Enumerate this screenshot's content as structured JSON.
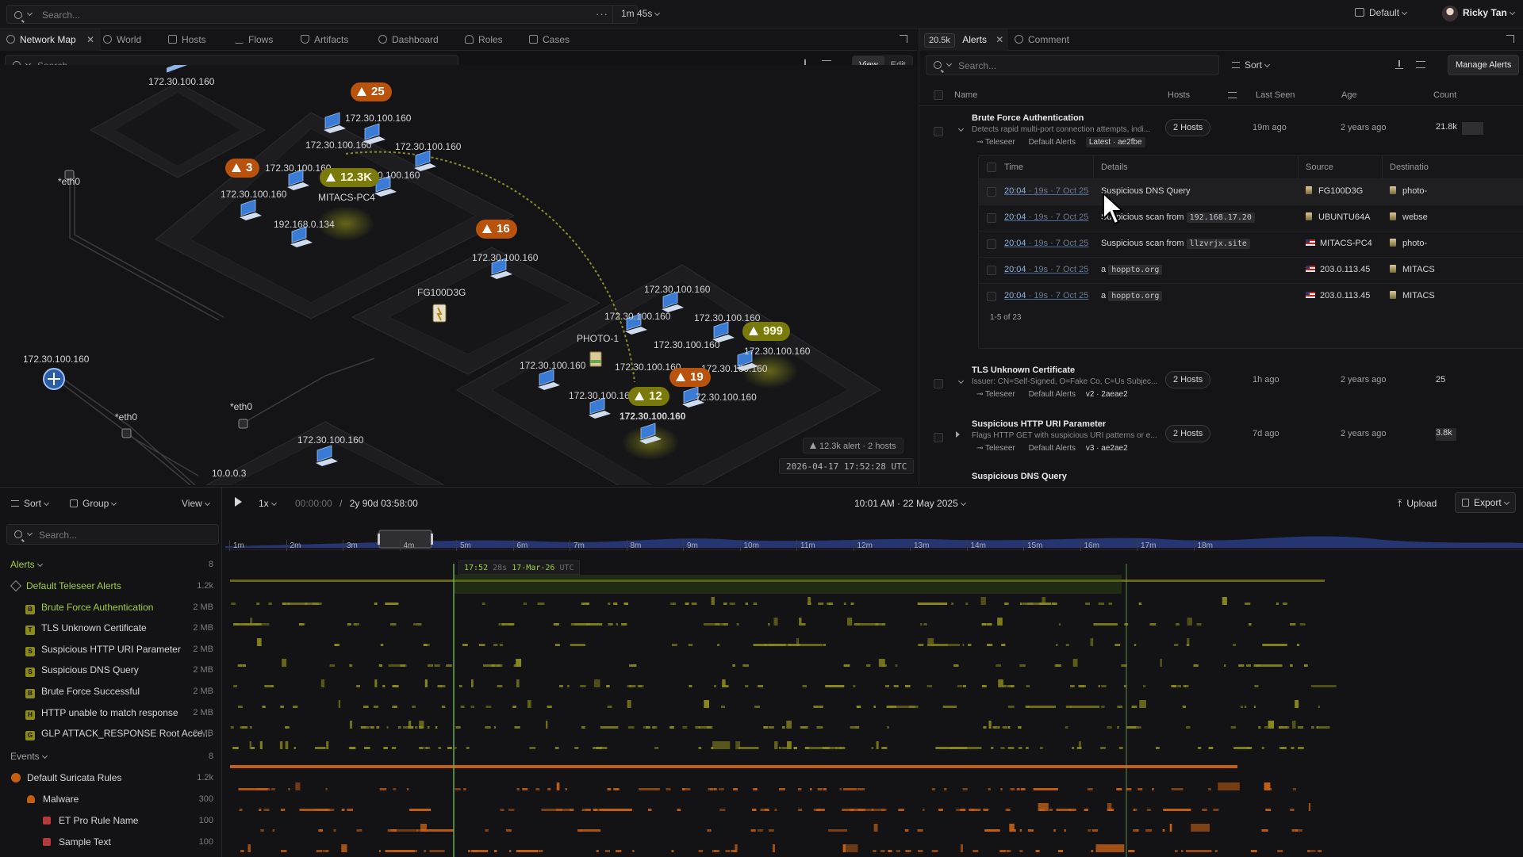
{
  "topbar": {
    "search_placeholder": "Search...",
    "time_range": "1m 45s",
    "layout": "Default",
    "user": "Ricky Tan"
  },
  "left_tabs": [
    {
      "label": "Network Map",
      "active": true
    },
    {
      "label": "World"
    },
    {
      "label": "Hosts"
    },
    {
      "label": "Flows"
    },
    {
      "label": "Artifacts"
    },
    {
      "label": "Dashboard"
    },
    {
      "label": "Roles"
    },
    {
      "label": "Cases"
    }
  ],
  "map": {
    "search_placeholder": "Search...",
    "view_label": "View",
    "edit_label": "Edit",
    "badges": [
      "25",
      "3",
      "12.3K",
      "16",
      "999",
      "19",
      "12"
    ],
    "labels": {
      "n1": "172.30.100.160",
      "n2": "172.30.100.160",
      "n3": "172.30.100.160",
      "n4": "172.30.100.160",
      "n5": "172.30.100.160",
      "n6": "172.30.100.160",
      "n7": "0.100.160",
      "mitacs": "MITACS-PC4",
      "ip192": "192.168.0.134",
      "eth0a": "*eth0",
      "eth0b": "*eth0",
      "eth0c": "*eth0",
      "fg": "FG100D3G",
      "left1": "172.30.100.160",
      "mid16": "172.30.100.160",
      "photo": "PHOTO-1",
      "r1": "172.30.100.160",
      "r2": "172.30.100.160",
      "r3": "172.30.100.160",
      "r4": "172.30.100.160",
      "r5": "172.30.100.160",
      "r6": "172.30.100.160",
      "r7": "172.30.100.160",
      "r8": "172.30.100.160",
      "r9": "72.30.100.160",
      "r10": "172.30.100.160",
      "r11": "172.30.100.160",
      "bottom1": "172.30.100.160",
      "ten": "10.0.0.3",
      "bottom2": "172.30.100.160"
    },
    "alert_chip": "12.3k alert · 2 hosts",
    "timestamp": "2026-04-17 17:52:28 UTC"
  },
  "alerts_panel": {
    "count_badge": "20.5k",
    "tab_alerts": "Alerts",
    "tab_comment": "Comment",
    "search_placeholder": "Search...",
    "sort_label": "Sort",
    "manage_label": "Manage Alerts",
    "columns": [
      "Name",
      "Hosts",
      "Last Seen",
      "Age",
      "Count"
    ],
    "rows": [
      {
        "name": "Brute Force Authentication",
        "desc": "Detects rapid multi-port connection attempts, indi...",
        "source": "Teleseer",
        "group": "Default Alerts",
        "version": "Latest · ae2fbe",
        "hosts": "2 Hosts",
        "last_seen": "19m ago",
        "age": "2 years ago",
        "count": "21.8k"
      },
      {
        "name": "TLS Unknown Certificate",
        "desc": "Issuer: CN=Self-Signed, O=Fake Co, C=Us Subjec...",
        "source": "Teleseer",
        "group": "Default Alerts",
        "version": "v2 · 2aeae2",
        "hosts": "2 Hosts",
        "last_seen": "1h ago",
        "age": "2 years ago",
        "count": "25"
      },
      {
        "name": "Suspicious HTTP URI Parameter",
        "desc": "Flags HTTP GET with suspicious URI patterns or e...",
        "source": "Teleseer",
        "group": "Default Alerts",
        "version": "v3 · ae2ae2",
        "hosts": "2 Hosts",
        "last_seen": "7d ago",
        "age": "2 years ago",
        "count": "3.8k"
      },
      {
        "name": "Suspicious DNS Query"
      }
    ],
    "sub_columns": [
      "Time",
      "Details",
      "Source",
      "Destinatio"
    ],
    "sub_rows": [
      {
        "time": "20:04",
        "rel": "· 19s · 7 Oct 25",
        "pre": "Suspicious DNS Query",
        "code": "",
        "source": "FG100D3G",
        "dest": "photo-"
      },
      {
        "time": "20:04",
        "rel": "· 19s · 7 Oct 25",
        "pre": "Suspicious scan from",
        "code": "192.168.17.20",
        "source": "UBUNTU64A",
        "dest": "webse"
      },
      {
        "time": "20:04",
        "rel": "· 19s · 7 Oct 25",
        "pre": "Suspicious scan from",
        "code": "llzvrjx.site",
        "source": "MITACS-PC4",
        "dest": "photo-"
      },
      {
        "time": "20:04",
        "rel": "· 19s · 7 Oct 25",
        "pre": "a",
        "code": "hoppto.org",
        "source": "203.0.113.45",
        "dest": "MITACS"
      },
      {
        "time": "20:04",
        "rel": "· 19s · 7 Oct 25",
        "pre": "a",
        "code": "hoppto.org",
        "source": "203.0.113.45",
        "dest": "MITACS"
      }
    ],
    "pagination": "1-5 of 23"
  },
  "timeline": {
    "sort_label": "Sort",
    "group_label": "Group",
    "view_label": "View",
    "speed": "1x",
    "current": "00:00:00",
    "separator": "/",
    "duration": "2y 90d 03:58:00",
    "datetime": "10:01 AM · 22 May 2025",
    "upload_label": "Upload",
    "export_label": "Export",
    "search_placeholder": "Search...",
    "ticks": [
      "1m",
      "2m",
      "3m",
      "4m",
      "5m",
      "6m",
      "7m",
      "8m",
      "9m",
      "10m",
      "11m",
      "12m",
      "13m",
      "14m",
      "15m",
      "16m",
      "17m",
      "18m"
    ],
    "cursor_time": "17:52",
    "cursor_sec": "28s",
    "cursor_date": "17-Mar-26",
    "cursor_tz": "UTC",
    "groups": [
      {
        "label": "Alerts",
        "count": "8"
      },
      {
        "label": "Events",
        "count": "8"
      }
    ],
    "items": [
      {
        "label": "Default Teleseer Alerts",
        "size": "1.2k"
      },
      {
        "letter": "B",
        "label": "Brute Force Authentication",
        "size": "2 MB"
      },
      {
        "letter": "T",
        "label": "TLS Unknown Certificate",
        "size": "2 MB"
      },
      {
        "letter": "S",
        "label": "Suspicious HTTP URI Parameter",
        "size": "2 MB"
      },
      {
        "letter": "S",
        "label": "Suspicious DNS Query",
        "size": "2 MB"
      },
      {
        "letter": "B",
        "label": "Brute Force Successful",
        "size": "2 MB"
      },
      {
        "letter": "H",
        "label": "HTTP unable to match response",
        "size": "2 MB"
      },
      {
        "letter": "G",
        "label": "GLP ATTACK_RESPONSE Root Acce...",
        "size": "2 MB"
      },
      {
        "label": "Default Suricata Rules",
        "size": "1.2k"
      },
      {
        "label": "Malware",
        "size": "300"
      },
      {
        "label": "ET Pro Rule Name",
        "size": "100"
      },
      {
        "label": "Sample Text",
        "size": "100"
      }
    ]
  },
  "colors": {
    "accent_green": "#9fcf3c",
    "alert_orange": "#b8520c",
    "alert_yellow": "#7a7a0c",
    "track_yellow": "#8c8a1a",
    "track_orange": "#c45f12"
  }
}
